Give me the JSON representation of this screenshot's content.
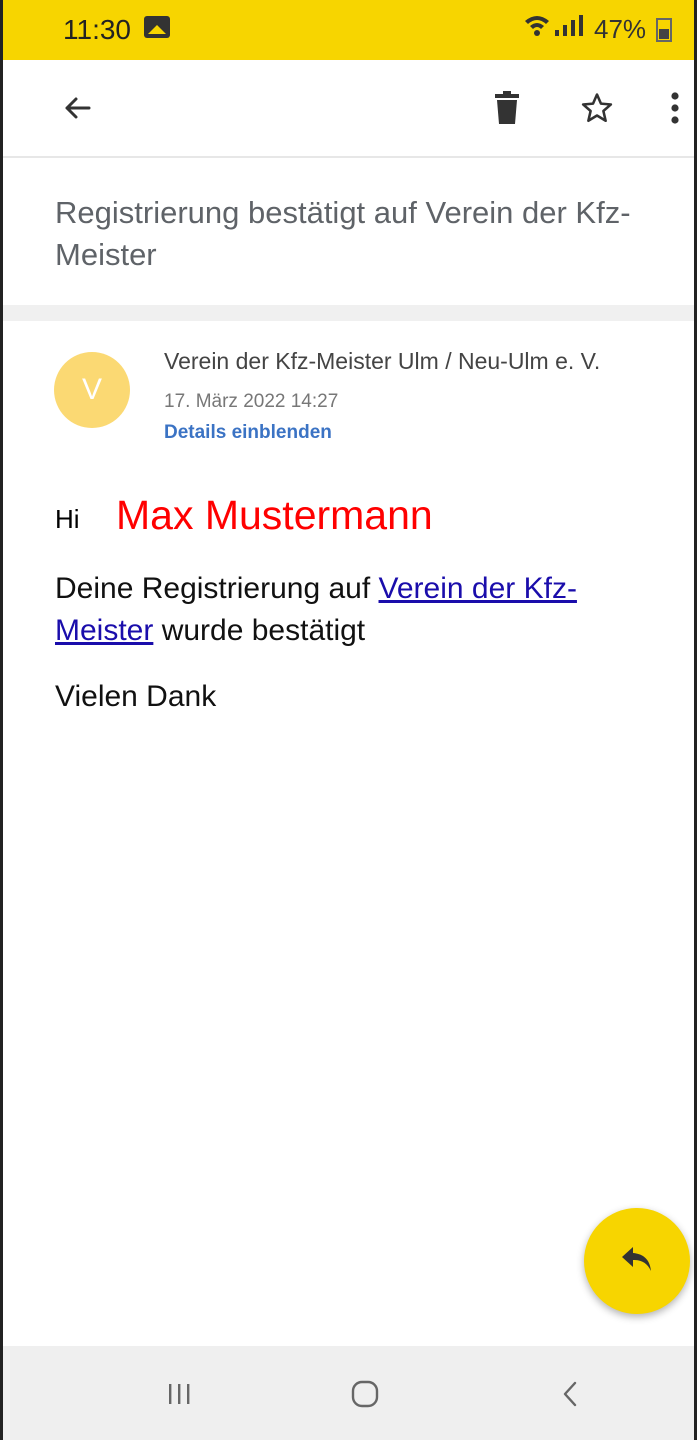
{
  "status_bar": {
    "time": "11:30",
    "battery": "47%",
    "accent_color": "#f7d500"
  },
  "app_bar": {
    "back_icon": "arrow-left-icon",
    "delete_icon": "trash-icon",
    "star_icon": "star-outline-icon",
    "more_icon": "more-vertical-icon"
  },
  "email": {
    "subject": "Registrierung bestätigt auf Verein der Kfz-Meister",
    "avatar_letter": "V",
    "sender": "Verein der Kfz-Meister Ulm / Neu-Ulm e. V.",
    "date": "17. März 2022 14:27",
    "details_link": "Details einblenden",
    "greeting": "Hi",
    "name": "Max Mustermann",
    "body_before_link": "Deine Registrierung auf ",
    "link_text": "Verein der Kfz-Meister",
    "body_after_link": " wurde bestätigt",
    "closing": "Vielen Dank"
  },
  "fab": {
    "icon": "reply-icon"
  },
  "nav_bar": {
    "recents_icon": "recents-icon",
    "home_icon": "home-icon",
    "back_icon": "back-chevron-icon"
  }
}
